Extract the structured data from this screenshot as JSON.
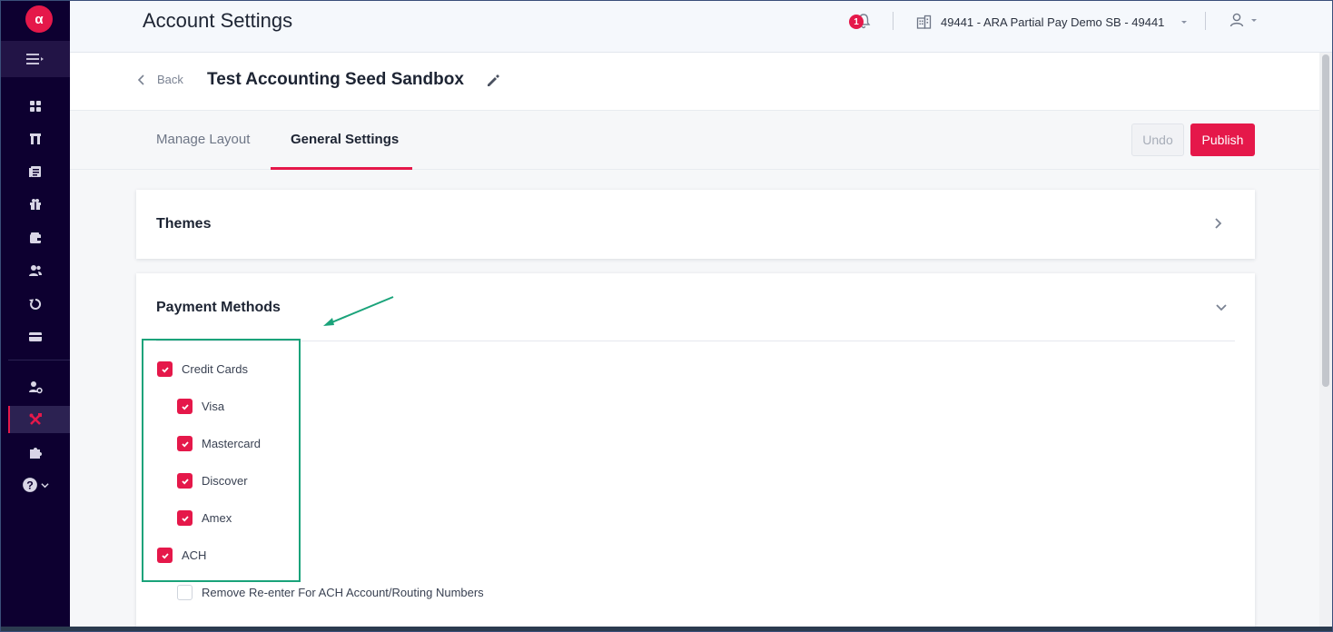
{
  "colors": {
    "brand": "#e5184a",
    "sidebar": "#0d0030",
    "highlight": "#1aa37a"
  },
  "logo": {
    "text": "α"
  },
  "sidebar": {
    "items": [
      {
        "icon": "dashboard-icon"
      },
      {
        "icon": "columns-icon"
      },
      {
        "icon": "invoices-icon"
      },
      {
        "icon": "gift-icon"
      },
      {
        "icon": "wallet-icon"
      },
      {
        "icon": "users-icon"
      },
      {
        "icon": "refresh-icon"
      },
      {
        "icon": "card-icon"
      },
      {
        "icon": "user-settings-icon"
      },
      {
        "icon": "tools-icon",
        "active": true
      },
      {
        "icon": "puzzle-icon"
      },
      {
        "icon": "help-icon"
      }
    ]
  },
  "header": {
    "title": "Account Settings",
    "notification_count": "1",
    "account_label": "49441 - ARA Partial Pay Demo SB - 49441"
  },
  "subheader": {
    "back_label": "Back",
    "title": "Test Accounting Seed Sandbox"
  },
  "tabs": [
    {
      "label": "Manage Layout"
    },
    {
      "label": "General Settings",
      "active": true
    }
  ],
  "actions": {
    "undo_label": "Undo",
    "publish_label": "Publish"
  },
  "themes": {
    "title": "Themes"
  },
  "payment_methods": {
    "title": "Payment Methods",
    "options": [
      {
        "label": "Credit Cards",
        "checked": true
      },
      {
        "label": "Visa",
        "checked": true
      },
      {
        "label": "Mastercard",
        "checked": true
      },
      {
        "label": "Discover",
        "checked": true
      },
      {
        "label": "Amex",
        "checked": true
      },
      {
        "label": "ACH",
        "checked": true
      },
      {
        "label": "Remove Re-enter For ACH Account/Routing Numbers",
        "checked": false
      }
    ]
  }
}
